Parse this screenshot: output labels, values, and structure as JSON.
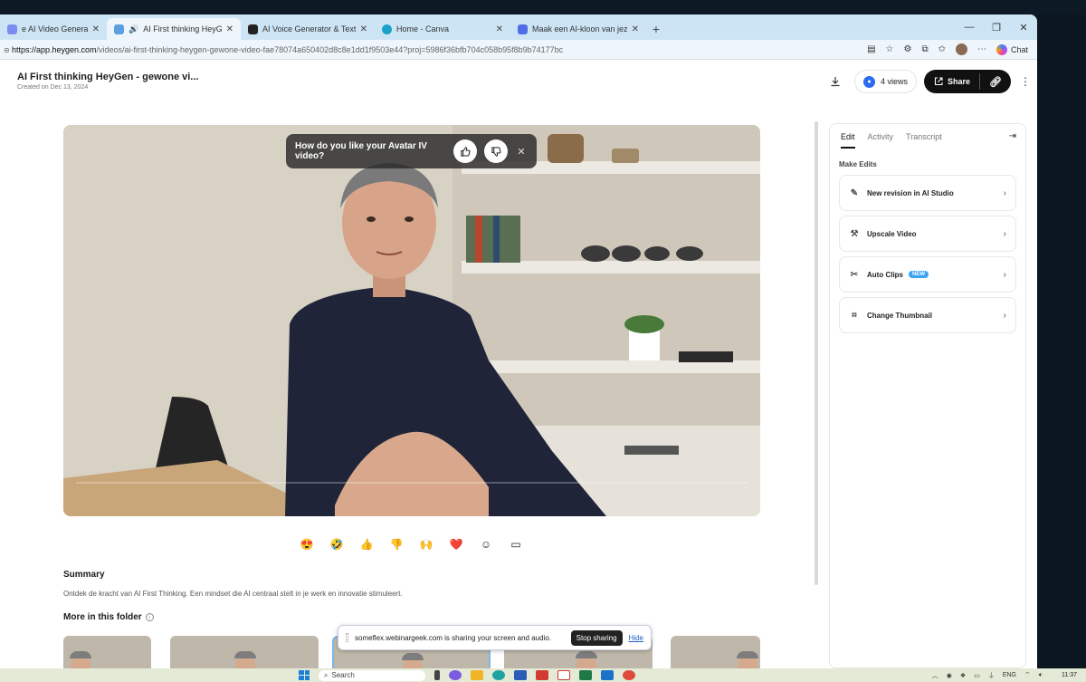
{
  "browser": {
    "tabs": [
      {
        "title": "e AI Video Generator: Create S",
        "active": false,
        "favicon_color": "#7c8cf0"
      },
      {
        "title": "AI First thinking HeyGen - ge",
        "active": true,
        "favicon_color": "#5aa0e0",
        "audio": true
      },
      {
        "title": "AI Voice Generator & Text to Spe",
        "active": false,
        "favicon_color": "#222222"
      },
      {
        "title": "Home - Canva",
        "active": false,
        "favicon_color": "#1aa3c9"
      },
      {
        "title": "Maak een AI-kloon van jezelf",
        "active": false,
        "favicon_color": "#4f6de6"
      }
    ],
    "close_glyph": "✕",
    "newtab_glyph": "+",
    "url_host": "https://app.heygen.com",
    "url_path": "/videos/ai-first-thinking-heygen-gewone-video-fae78074a650402d8c8e1dd1f9503e44?proj=5986f36bfb704c058b95f8b9b74177bc",
    "chat_label": "Chat"
  },
  "header": {
    "title": "AI First thinking HeyGen - gewone vi...",
    "created": "Created on Dec 13, 2024",
    "views_label": "4 views",
    "share_label": "Share"
  },
  "video": {
    "feedback_question": "How do you like your Avatar IV video?",
    "feedback_up_icon": "thumbs-up",
    "feedback_down_icon": "thumbs-down"
  },
  "reactions": [
    {
      "name": "heart-eyes",
      "glyph": "😍"
    },
    {
      "name": "laugh",
      "glyph": "🤣"
    },
    {
      "name": "thumbs-up",
      "glyph": "👍"
    },
    {
      "name": "thumbs-down",
      "glyph": "👎"
    },
    {
      "name": "clap",
      "glyph": "🙌"
    },
    {
      "name": "heart",
      "glyph": "❤️"
    },
    {
      "name": "add-reaction",
      "glyph": "☺"
    },
    {
      "name": "comment",
      "glyph": "▭"
    }
  ],
  "summary": {
    "heading": "Summary",
    "text": "Ontdek de kracht van AI First Thinking. Een mindset die AI centraal stelt in je werk en innovatie stimuleert."
  },
  "folder": {
    "heading": "More in this folder",
    "info_glyph": "i",
    "thumb_count": 5
  },
  "screen_share": {
    "message": "someflex.webinargeek.com is sharing your screen and audio.",
    "stop_label": "Stop sharing",
    "hide_label": "Hide"
  },
  "panel": {
    "tabs": [
      "Edit",
      "Activity",
      "Transcript"
    ],
    "active_tab": "Edit",
    "section_heading": "Make Edits",
    "items": [
      {
        "label": "New revision in AI Studio",
        "icon": "edit-icon",
        "glyph": "✎"
      },
      {
        "label": "Upscale Video",
        "icon": "magic-wand-icon",
        "glyph": "⚒"
      },
      {
        "label": "Auto Clips",
        "icon": "scissors-icon",
        "glyph": "✂",
        "badge": "NEW"
      },
      {
        "label": "Change Thumbnail",
        "icon": "thumbnail-icon",
        "glyph": "⌗"
      }
    ]
  },
  "taskbar": {
    "search_label": "Search",
    "lang": "ENG",
    "time": "11:37"
  },
  "colors": {
    "accent_blue": "#2c6cf0",
    "badge_new": "#3aa4f4",
    "share_bg": "#111111",
    "tabstrip": "#cde4f5"
  }
}
